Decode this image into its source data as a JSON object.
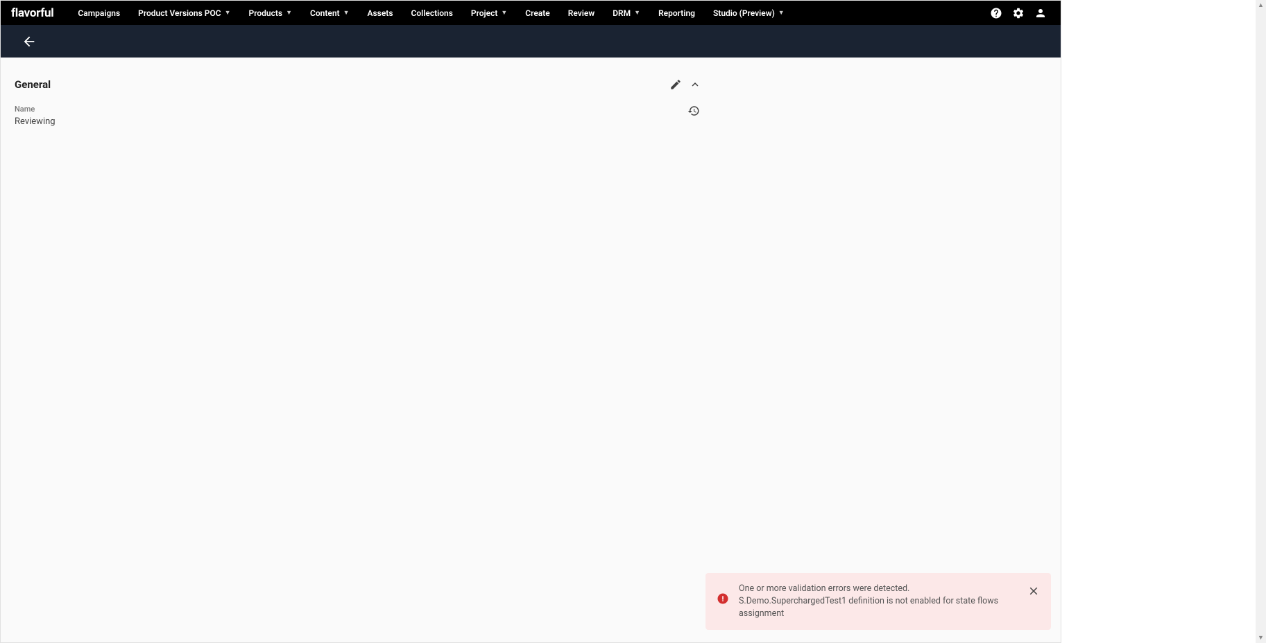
{
  "brand": "flavorful",
  "nav": {
    "items": [
      {
        "label": "Campaigns",
        "dropdown": false
      },
      {
        "label": "Product Versions POC",
        "dropdown": true
      },
      {
        "label": "Products",
        "dropdown": true
      },
      {
        "label": "Content",
        "dropdown": true
      },
      {
        "label": "Assets",
        "dropdown": false
      },
      {
        "label": "Collections",
        "dropdown": false
      },
      {
        "label": "Project",
        "dropdown": true
      },
      {
        "label": "Create",
        "dropdown": false
      },
      {
        "label": "Review",
        "dropdown": false
      },
      {
        "label": "DRM",
        "dropdown": true
      },
      {
        "label": "Reporting",
        "dropdown": false
      },
      {
        "label": "Studio (Preview)",
        "dropdown": true
      }
    ]
  },
  "section": {
    "title": "General",
    "fields": {
      "name": {
        "label": "Name",
        "value": "Reviewing"
      }
    }
  },
  "error": {
    "line1": "One or more validation errors were detected.",
    "line2": "S.Demo.SuperchargedTest1 definition is not enabled for state flows assignment"
  }
}
